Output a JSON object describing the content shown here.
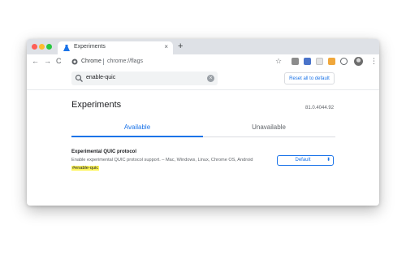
{
  "browser": {
    "tab": {
      "title": "Experiments",
      "close": "×",
      "icon": "experiments-flask-icon"
    },
    "new_tab": "+",
    "nav": {
      "back": "←",
      "forward": "→",
      "reload": "C"
    },
    "omnibox": {
      "site_name": "Chrome",
      "url": "chrome://flags"
    },
    "bookmark_star": "☆",
    "menu": "⋮"
  },
  "header": {
    "search": {
      "value": "enable-quic",
      "clear": "×"
    },
    "reset_button": "Reset all to default"
  },
  "main": {
    "title": "Experiments",
    "version": "81.0.4044.92",
    "tabs": [
      "Available",
      "Unavailable"
    ]
  },
  "flag": {
    "title": "Experimental QUIC protocol",
    "description": "Enable experimental QUIC protocol support. – Mac, Windows, Linux, Chrome OS, Android",
    "link": "#enable-quic",
    "select_value": "Default",
    "select_arrow": "⬍"
  },
  "colors": {
    "accent": "#1a73e8",
    "highlight": "#fdf55b",
    "tabstrip": "#dee1e6"
  }
}
